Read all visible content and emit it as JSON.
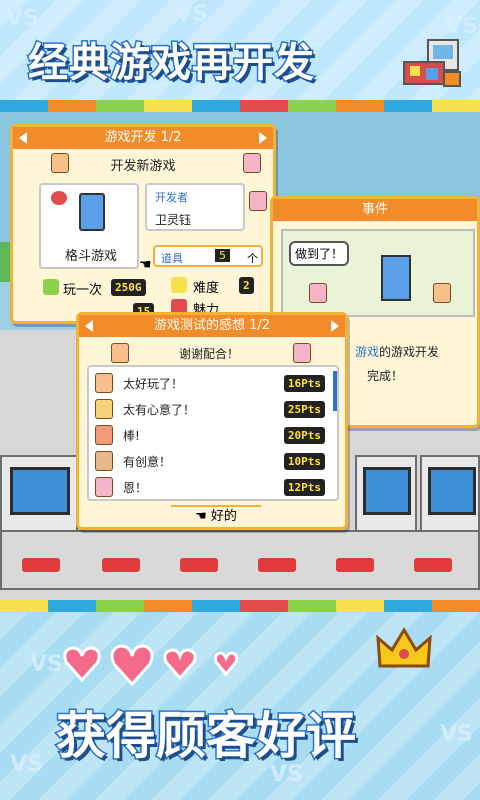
{
  "top_title": "经典游戏再开发",
  "bottom_title": "获得顾客好评",
  "vs_text": "VS",
  "colors": {
    "orange": "#f28c28",
    "blue": "#2b73c9",
    "gold": "#f2b23a",
    "stripe": [
      "#2fa8e0",
      "#f28c28",
      "#8bd14a",
      "#f6e04c",
      "#2fa8e0",
      "#e34a4a",
      "#8bd14a",
      "#f28c28",
      "#2fa8e0",
      "#f6e04c"
    ]
  },
  "dev_window": {
    "header": "游戏开发 1/2",
    "subtitle": "开发新游戏",
    "game_name": "格斗游戏",
    "developer_label": "开发者",
    "developer_name": "卫灵钰",
    "item_label": "道具",
    "item_value": "5",
    "item_unit": "个",
    "play_label": "玩一次",
    "play_value": "250G",
    "difficulty_label": "难度",
    "difficulty_value": "2",
    "charm_label": "魅力",
    "partial_value": "15"
  },
  "event_window": {
    "header": "事件",
    "speech": "做到了！",
    "text_highlight": "游戏",
    "text_line1": "的游戏开发",
    "text_line2": "完成！"
  },
  "feedback_window": {
    "header": "游戏测试的感想 1/2",
    "thanks": "谢谢配合！",
    "confirm": "好的",
    "rows": [
      {
        "comment": "太好玩了！",
        "pts": "16Pts"
      },
      {
        "comment": "太有心意了！",
        "pts": "25Pts"
      },
      {
        "comment": "棒!",
        "pts": "20Pts"
      },
      {
        "comment": "有创意！",
        "pts": "10Pts"
      },
      {
        "comment": "恩！",
        "pts": "12Pts"
      }
    ]
  }
}
